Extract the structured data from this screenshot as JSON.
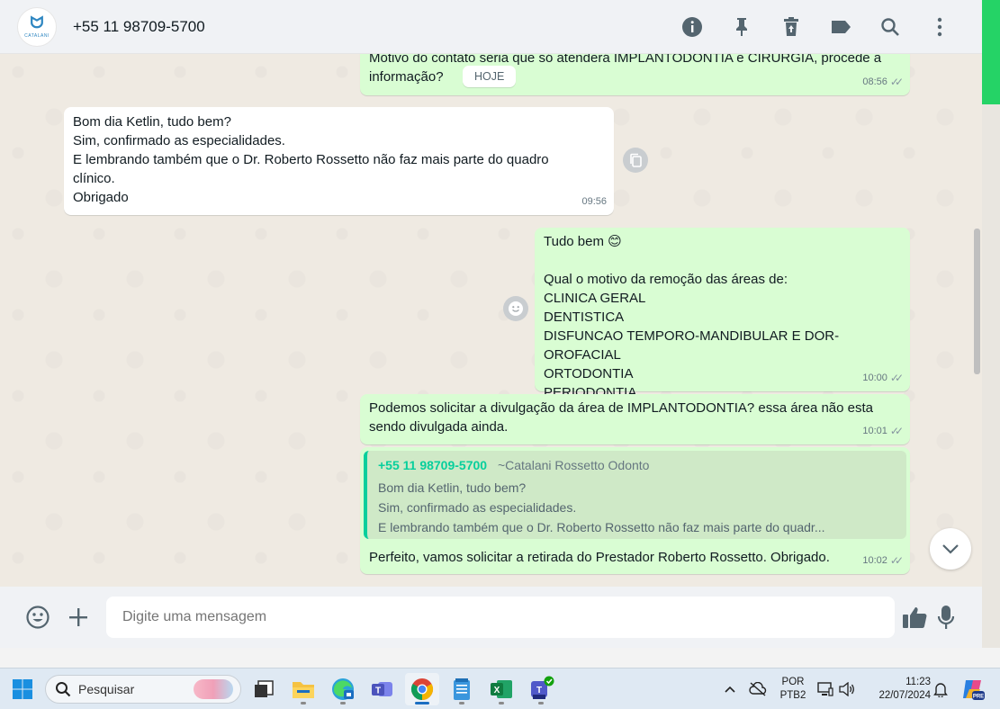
{
  "header": {
    "contact_name": "+55 11 98709-5700",
    "avatar_text": "CATALANI",
    "icons": [
      "info-icon",
      "pin-icon",
      "delete-icon",
      "label-icon",
      "search-icon",
      "menu-icon"
    ]
  },
  "chat": {
    "date_divider": "HOJE",
    "messages": [
      {
        "direction": "outgoing",
        "text": "Motivo do contato seria que só atenderá IMPLANTODONTIA e CIRURGIA, procede a\ninformação?",
        "time": "08:56"
      },
      {
        "direction": "incoming",
        "text": "Bom dia Ketlin, tudo bem?\nSim, confirmado as especialidades.\nE lembrando também que o Dr. Roberto Rossetto não faz mais parte do quadro\nclínico.\nObrigado",
        "time": "09:56"
      },
      {
        "direction": "outgoing",
        "text": "Tudo bem 😊\n\nQual o motivo da remoção das áreas de:\nCLINICA GERAL\nDENTISTICA\nDISFUNCAO TEMPORO-MANDIBULAR E DOR-OROFACIAL\nORTODONTIA\nPERIODONTIA",
        "time": "10:00"
      },
      {
        "direction": "outgoing",
        "text": "Podemos solicitar a divulgação da área de IMPLANTODONTIA? essa área não esta\nsendo divulgada ainda.",
        "time": "10:01"
      },
      {
        "direction": "outgoing",
        "text": "Perfeito, vamos solicitar a retirada do Prestador Roberto Rossetto. Obrigado.",
        "time": "10:02",
        "quote": {
          "name": "+55 11 98709-5700",
          "push_name": "~Catalani Rossetto Odonto",
          "lines": [
            "Bom dia Ketlin, tudo bem?",
            "Sim, confirmado as especialidades.",
            "E lembrando também que o Dr. Roberto Rossetto não faz mais parte do quadr..."
          ]
        }
      }
    ]
  },
  "compose": {
    "placeholder": "Digite uma mensagem"
  },
  "taskbar": {
    "search_label": "Pesquisar",
    "language": "POR",
    "keyboard": "PTB2",
    "time": "11:23",
    "date": "22/07/2024",
    "apps": [
      "task-view",
      "file-explorer",
      "edge",
      "teams-classic",
      "chrome",
      "notepad",
      "excel",
      "teams-new"
    ]
  },
  "colors": {
    "outgoing_bubble": "#d9fdd3",
    "incoming_bubble": "#ffffff",
    "accent": "#06cf9c",
    "strip": "#25d366"
  }
}
